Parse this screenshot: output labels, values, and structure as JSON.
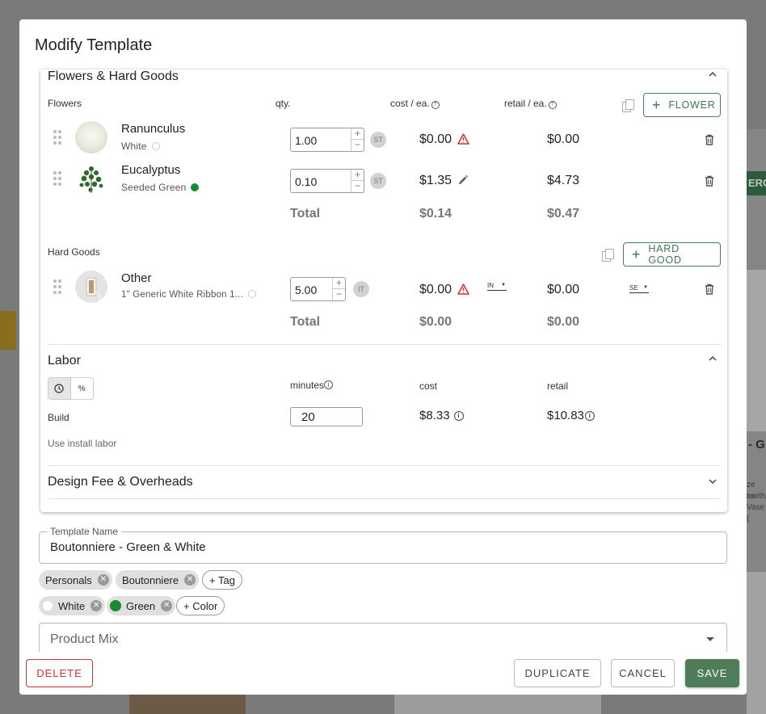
{
  "modal": {
    "title": "Modify Template"
  },
  "flowers_section": {
    "title": "Flowers & Hard Goods",
    "flowers_header": {
      "label": "Flowers",
      "qty": "qty.",
      "cost": "cost / ea.",
      "retail": "retail / ea.",
      "add_button": "FLOWER"
    },
    "flowers": [
      {
        "name": "Ranunculus",
        "color": "White",
        "qty": "1.00",
        "unit": "ST",
        "cost": "$0.00",
        "retail": "$0.00"
      },
      {
        "name": "Eucalyptus",
        "color": "Seeded Green",
        "qty": "0.10",
        "unit": "ST",
        "cost": "$1.35",
        "retail": "$4.73"
      }
    ],
    "flowers_total": {
      "label": "Total",
      "cost": "$0.14",
      "retail": "$0.47"
    },
    "hardgoods_header": {
      "label": "Hard Goods",
      "add_button": "HARD GOOD"
    },
    "hardgoods": [
      {
        "name": "Other",
        "desc": "1\" Generic White Ribbon 1...",
        "qty": "5.00",
        "unit": "IT",
        "cost": "$0.00",
        "cost_unit": "IN",
        "retail": "$0.00",
        "retail_unit": "SE"
      }
    ],
    "hardgoods_total": {
      "label": "Total",
      "cost": "$0.00",
      "retail": "$0.00"
    }
  },
  "labor": {
    "title": "Labor",
    "minutes_label": "minutes",
    "cost_label": "cost",
    "retail_label": "retail",
    "build_label": "Build",
    "minutes_value": "20",
    "cost_value": "$8.33",
    "retail_value": "$10.83",
    "install_text": "Use install labor"
  },
  "design_fee": {
    "title": "Design Fee & Overheads"
  },
  "template_name": {
    "label": "Template Name",
    "value": "Boutonniere - Green & White"
  },
  "tags": [
    "Personals",
    "Boutonniere"
  ],
  "add_tag": "+ Tag",
  "colors": [
    {
      "name": "White",
      "hex": "#ffffff"
    },
    {
      "name": "Green",
      "hex": "#1a8a2e"
    }
  ],
  "add_color": "+ Color",
  "product_mix": {
    "placeholder": "Product Mix"
  },
  "footer": {
    "delete": "DELETE",
    "duplicate": "DUPLICATE",
    "cancel": "CANCEL",
    "save": "SAVE"
  },
  "background": {
    "button_fragment": "ERCI",
    "right_heading": "- G",
    "right_text": [
      "ze an",
      "t with",
      "Vase ("
    ]
  },
  "theme": {
    "accent": "#4f7d5a",
    "danger": "#c93434",
    "warning": "#d32f2f"
  }
}
